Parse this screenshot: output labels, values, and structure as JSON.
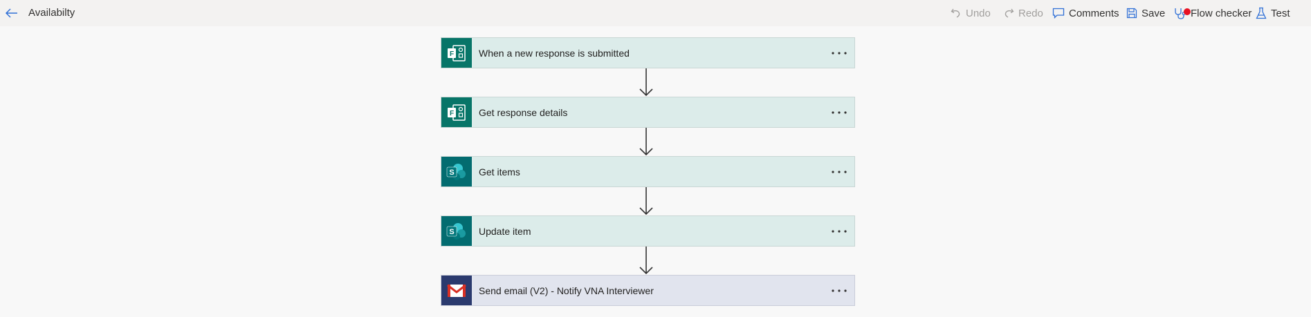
{
  "header": {
    "title": "Availabilty",
    "undo_label": "Undo",
    "redo_label": "Redo",
    "comments_label": "Comments",
    "save_label": "Save",
    "flow_checker_label": "Flow checker",
    "test_label": "Test"
  },
  "steps": [
    {
      "label": "When a new response is submitted",
      "icon": "forms-icon",
      "color": "#077568"
    },
    {
      "label": "Get response details",
      "icon": "forms-icon",
      "color": "#077568"
    },
    {
      "label": "Get items",
      "icon": "sharepoint-icon",
      "color": "#036c70"
    },
    {
      "label": "Update item",
      "icon": "sharepoint-icon",
      "color": "#036c70"
    },
    {
      "label": "Send email (V2) - Notify VNA Interviewer",
      "icon": "gmail-icon",
      "color": "#2b3a6e"
    }
  ],
  "colors": {
    "accent": "#0078d4",
    "step_background": "#dcecea",
    "email_step_background": "#e1e4ee",
    "flow_checker_badge": "#e81123"
  }
}
